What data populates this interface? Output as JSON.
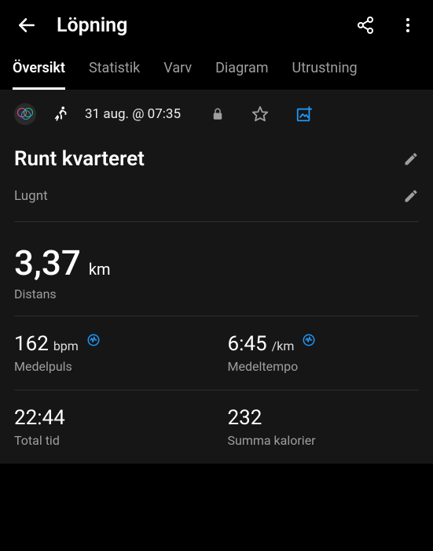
{
  "header": {
    "title": "Löpning"
  },
  "tabs": [
    {
      "label": "Översikt",
      "active": true
    },
    {
      "label": "Statistik",
      "active": false
    },
    {
      "label": "Varv",
      "active": false
    },
    {
      "label": "Diagram",
      "active": false
    },
    {
      "label": "Utrustning",
      "active": false
    }
  ],
  "activity": {
    "date": "31 aug. @ 07:35",
    "title": "Runt kvarteret",
    "subtitle": "Lugnt"
  },
  "stats": {
    "distance": {
      "value": "3,37",
      "unit": "km",
      "label": "Distans"
    },
    "avg_hr": {
      "value": "162",
      "unit": "bpm",
      "label": "Medelpuls"
    },
    "avg_pace": {
      "value": "6:45",
      "unit": "/km",
      "label": "Medeltempo"
    },
    "total_time": {
      "value": "22:44",
      "unit": "",
      "label": "Total tid"
    },
    "calories": {
      "value": "232",
      "unit": "",
      "label": "Summa kalorier"
    }
  },
  "icons": {
    "back": "back-arrow-icon",
    "share": "share-icon",
    "more": "more-vertical-icon",
    "connect": "connect-badge-icon",
    "runner": "runner-icon",
    "lock": "lock-icon",
    "star": "star-icon",
    "photo_add": "add-photo-icon",
    "edit": "pencil-icon",
    "pulse": "hr-graph-icon"
  },
  "colors": {
    "accent_blue": "#2196f3",
    "text_muted": "#9e9e9e",
    "bg_content": "#161616"
  }
}
